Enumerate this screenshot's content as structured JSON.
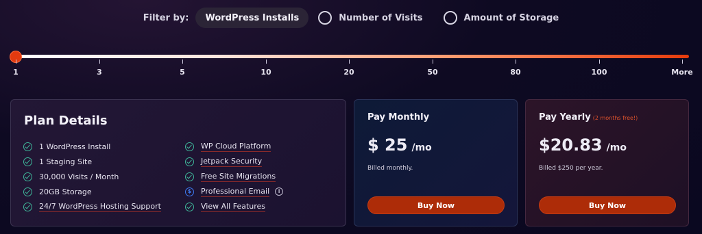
{
  "filter": {
    "label": "Filter by:",
    "options": [
      {
        "label": "WordPress Installs",
        "selected": true
      },
      {
        "label": "Number of Visits",
        "selected": false
      },
      {
        "label": "Amount of Storage",
        "selected": false
      }
    ]
  },
  "slider": {
    "value": "1",
    "ticks": [
      "1",
      "3",
      "5",
      "10",
      "20",
      "50",
      "80",
      "100",
      "More"
    ],
    "colors": {
      "thumb": "#e23a10",
      "track_start": "#ffffff",
      "track_end": "#e53b0c"
    }
  },
  "plan": {
    "title": "Plan Details",
    "features_left": [
      {
        "label": "1 WordPress Install",
        "icon": "check-circle-icon"
      },
      {
        "label": "1 Staging Site",
        "icon": "check-circle-icon"
      },
      {
        "label": "30,000 Visits / Month",
        "icon": "check-circle-icon"
      },
      {
        "label": "20GB Storage",
        "icon": "check-circle-icon"
      },
      {
        "label": "24/7 WordPress Hosting Support",
        "icon": "check-circle-icon"
      }
    ],
    "features_right": [
      {
        "label": "WP Cloud Platform",
        "icon": "check-circle-icon"
      },
      {
        "label": "Jetpack Security",
        "icon": "check-circle-icon"
      },
      {
        "label": "Free Site Migrations",
        "icon": "check-circle-icon"
      },
      {
        "label": "Professional Email",
        "icon": "dollar-circle-icon"
      },
      {
        "label": "View All Features",
        "icon": "check-circle-icon"
      }
    ]
  },
  "monthly": {
    "title": "Pay Monthly",
    "price": "$ 25",
    "unit": "/mo",
    "billed": "Billed monthly.",
    "button": "Buy Now"
  },
  "yearly": {
    "title": "Pay Yearly",
    "note": "(2 months free!)",
    "price": "$20.83",
    "unit": "/mo",
    "billed": "Billed $250 per year.",
    "button": "Buy Now"
  },
  "colors": {
    "accent": "#ad2c08",
    "check": "#3fb79a",
    "email_icon": "#3d7bf2"
  }
}
